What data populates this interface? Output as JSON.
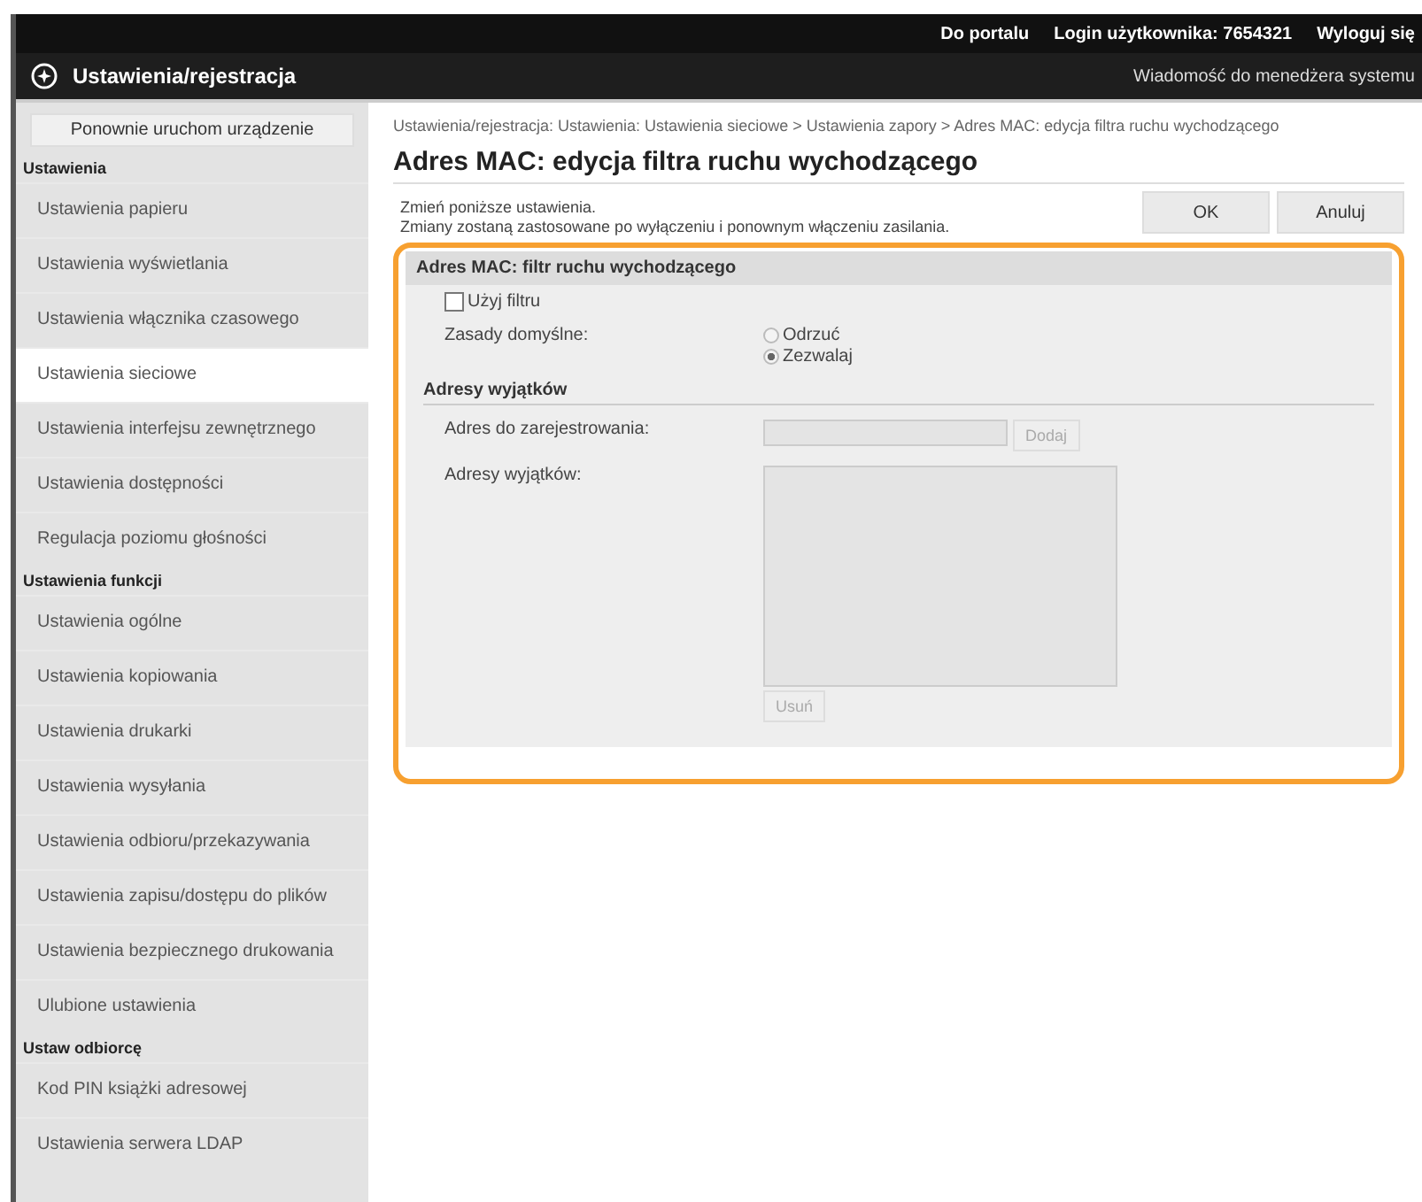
{
  "top_bar": {
    "links": [
      "Do portalu",
      "Login użytkownika: 7654321",
      "Wyloguj się"
    ]
  },
  "header": {
    "title": "Ustawienia/rejestracja",
    "message_link": "Wiadomość do menedżera systemu"
  },
  "sidebar": {
    "items": [
      {
        "kind": "button",
        "label": "Ponownie uruchom urządzenie"
      },
      {
        "kind": "header",
        "label": "Ustawienia"
      },
      {
        "kind": "item",
        "label": "Ustawienia papieru",
        "selected": false
      },
      {
        "kind": "item",
        "label": "Ustawienia wyświetlania",
        "selected": false
      },
      {
        "kind": "item",
        "label": "Ustawienia włącznika czasowego",
        "selected": false
      },
      {
        "kind": "item",
        "label": "Ustawienia sieciowe",
        "selected": true
      },
      {
        "kind": "item",
        "label": "Ustawienia interfejsu zewnętrznego",
        "selected": false
      },
      {
        "kind": "item",
        "label": "Ustawienia dostępności",
        "selected": false
      },
      {
        "kind": "item",
        "label": "Regulacja poziomu głośności",
        "selected": false
      },
      {
        "kind": "header",
        "label": "Ustawienia funkcji"
      },
      {
        "kind": "item",
        "label": "Ustawienia ogólne",
        "selected": false
      },
      {
        "kind": "item",
        "label": "Ustawienia kopiowania",
        "selected": false
      },
      {
        "kind": "item",
        "label": "Ustawienia drukarki",
        "selected": false
      },
      {
        "kind": "item",
        "label": "Ustawienia wysyłania",
        "selected": false
      },
      {
        "kind": "item",
        "label": "Ustawienia odbioru/przekazywania",
        "selected": false
      },
      {
        "kind": "item",
        "label": "Ustawienia zapisu/dostępu do plików",
        "selected": false
      },
      {
        "kind": "item",
        "label": "Ustawienia bezpiecznego drukowania",
        "selected": false
      },
      {
        "kind": "item",
        "label": "Ulubione ustawienia",
        "selected": false
      },
      {
        "kind": "header",
        "label": "Ustaw odbiorcę"
      },
      {
        "kind": "item",
        "label": "Kod PIN książki adresowej",
        "selected": false
      },
      {
        "kind": "item",
        "label": "Ustawienia serwera LDAP",
        "selected": false
      }
    ]
  },
  "breadcrumb": "Ustawienia/rejestracja: Ustawienia: Ustawienia sieciowe > Ustawienia zapory > Adres MAC: edycja filtra ruchu wychodzącego",
  "page_title": "Adres MAC: edycja filtra ruchu wychodzącego",
  "instructions": [
    "Zmień poniższe ustawienia.",
    "Zmiany zostaną zastosowane po wyłączeniu i ponownym włączeniu zasilania."
  ],
  "buttons": [
    "OK",
    "Anuluj"
  ],
  "panel": {
    "title": "Adres MAC: filtr ruchu wychodzącego",
    "use_filter": {
      "label": "Użyj filtru",
      "checked": false
    },
    "default_policy": {
      "label": "Zasady domyślne:",
      "options": [
        {
          "label": "Odrzuć",
          "selected": false
        },
        {
          "label": "Zezwalaj",
          "selected": true
        }
      ]
    },
    "exceptions": {
      "title": "Adresy wyjątków",
      "address_label": "Adres do zarejestrowania:",
      "add_button": {
        "label": "Dodaj",
        "disabled": true
      },
      "list_label": "Adresy wyjątków:",
      "remove_button": {
        "label": "Usuń",
        "disabled": true
      }
    }
  }
}
